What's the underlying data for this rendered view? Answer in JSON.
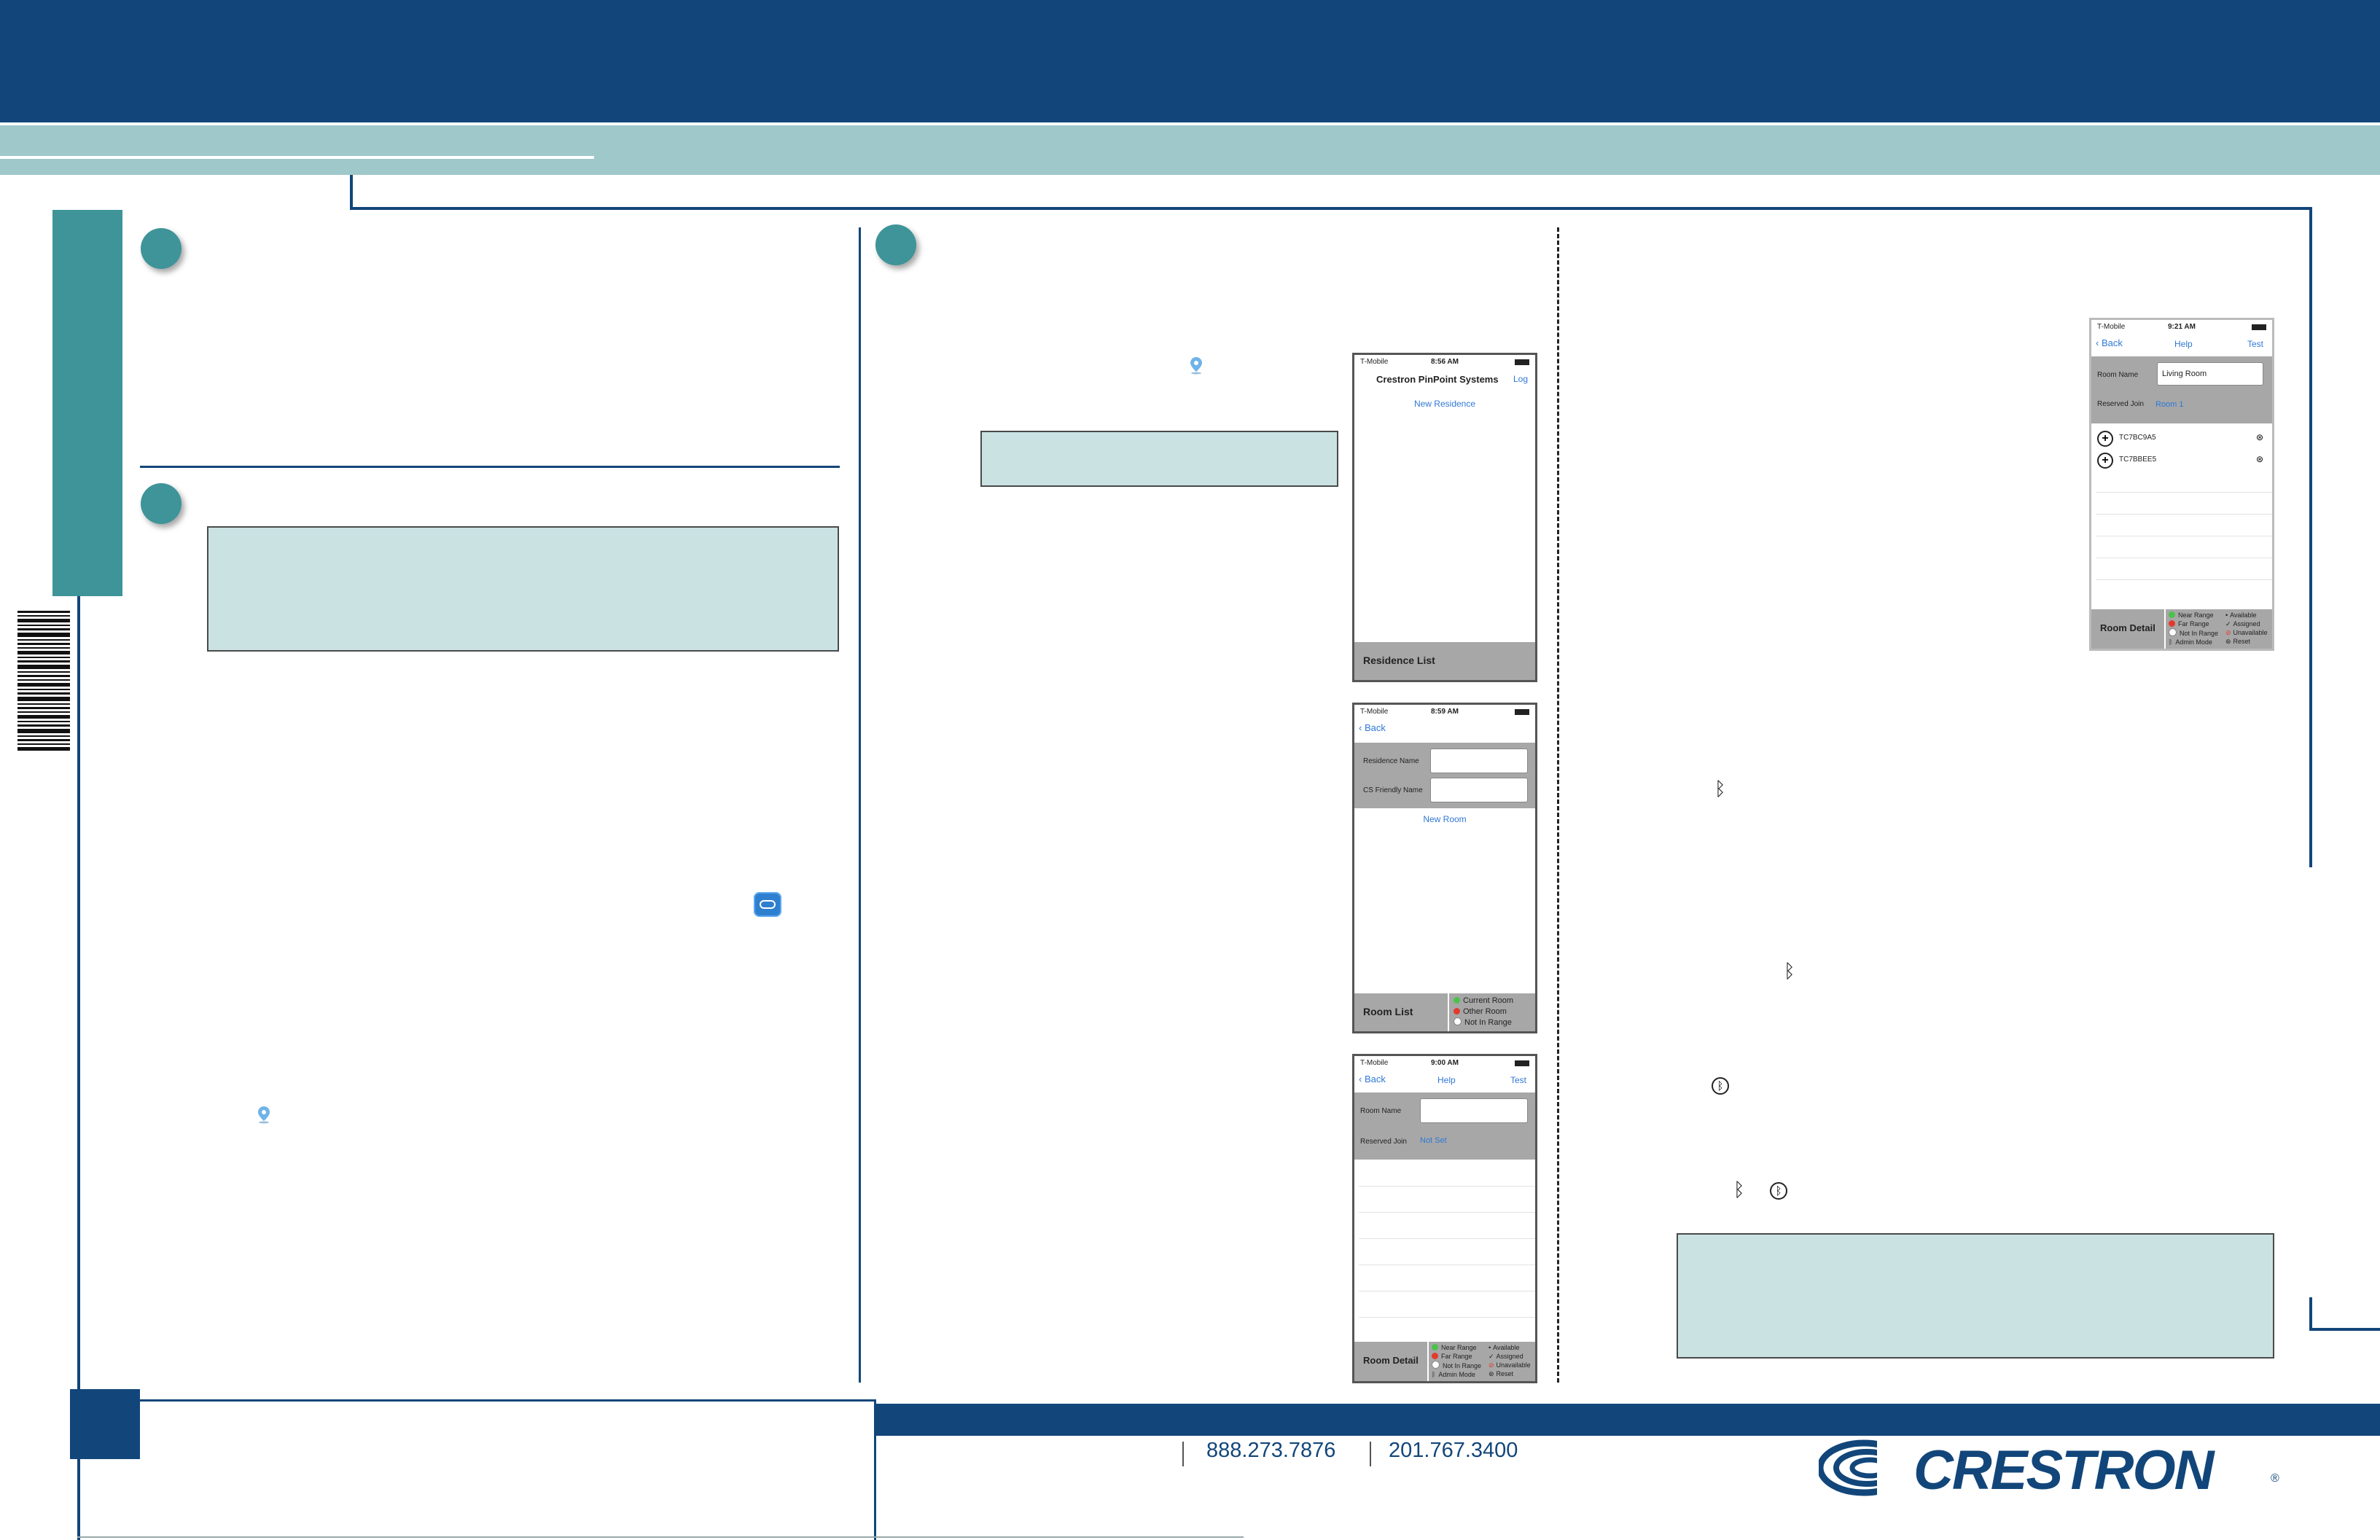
{
  "footer": {
    "phone_1": "888.273.7876",
    "phone_2": "201.767.3400",
    "brand": "CRESTRON",
    "registered_mark": "®"
  },
  "phone_residence_list": {
    "carrier": "T-Mobile",
    "time": "8:56 AM",
    "title": "Crestron PinPoint Systems",
    "nav_right": "Log",
    "link": "New Residence",
    "footer_title": "Residence List"
  },
  "phone_room_list": {
    "carrier": "T-Mobile",
    "time": "8:59 AM",
    "back": "Back",
    "residence_name_label": "Residence Name",
    "friendly_name_label": "CS Friendly Name",
    "link": "New Room",
    "footer_title": "Room List",
    "legend": [
      "Current Room",
      "Other Room",
      "Not In Range"
    ]
  },
  "phone_room_detail_empty": {
    "carrier": "T-Mobile",
    "time": "9:00 AM",
    "back": "Back",
    "help": "Help",
    "test": "Test",
    "room_name_label": "Room Name",
    "reserved_join_label": "Reserved Join",
    "reserved_join_value": "Not Set",
    "footer_title": "Room Detail",
    "legend_left": [
      "Near Range",
      "Far Range",
      "Not In Range",
      "Admin Mode"
    ],
    "legend_right": [
      "Available",
      "Assigned",
      "Unavailable",
      "Reset"
    ]
  },
  "phone_room_detail_living": {
    "carrier": "T-Mobile",
    "time": "9:21 AM",
    "back": "Back",
    "help": "Help",
    "test": "Test",
    "room_name_label": "Room Name",
    "room_name_value": "Living Room",
    "reserved_join_label": "Reserved Join",
    "reserved_join_value": "Room 1",
    "devices": [
      "TC7BC9A5",
      "TC7BBEE5"
    ],
    "footer_title": "Room Detail",
    "legend_left": [
      "Near Range",
      "Far Range",
      "Not In Range",
      "Admin Mode"
    ],
    "legend_right": [
      "Available",
      "Assigned",
      "Unavailable",
      "Reset"
    ]
  },
  "icons": {
    "location_pin": "location-pin-icon",
    "bluetooth": "bluetooth-icon",
    "bluetooth_circle": "bluetooth-circle-icon",
    "app": "app-icon"
  },
  "colors": {
    "navy": "#12467a",
    "teal": "#3e9499",
    "light_teal": "#9fc8ca",
    "note_fill": "#cbe2e3"
  }
}
